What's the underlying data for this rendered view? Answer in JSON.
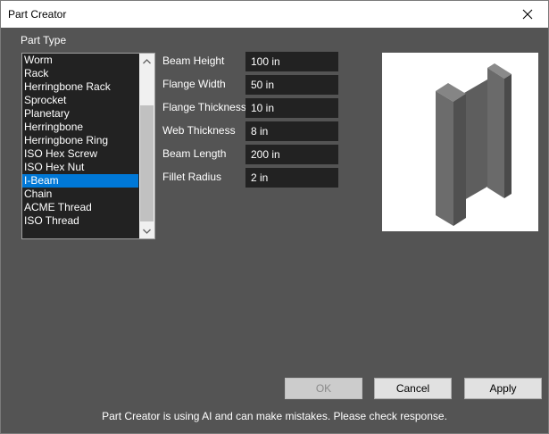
{
  "window": {
    "title": "Part Creator"
  },
  "part_type": {
    "label": "Part Type",
    "items": [
      "Worm",
      "Rack",
      "Herringbone Rack",
      "Sprocket",
      "Planetary",
      "Herringbone",
      "Herringbone Ring",
      "ISO Hex Screw",
      "ISO Hex Nut",
      "I-Beam",
      "Chain",
      "ACME Thread",
      "ISO Thread"
    ],
    "selected": "I-Beam"
  },
  "fields": [
    {
      "label": "Beam Height",
      "value": "100 in"
    },
    {
      "label": "Flange Width",
      "value": "50 in"
    },
    {
      "label": "Flange Thickness",
      "value": "10 in"
    },
    {
      "label": "Web Thickness",
      "value": "8 in"
    },
    {
      "label": "Beam Length",
      "value": "200 in"
    },
    {
      "label": "Fillet Radius",
      "value": "2 in"
    }
  ],
  "buttons": {
    "ok": "OK",
    "cancel": "Cancel",
    "apply": "Apply"
  },
  "footer": {
    "disclaimer": "Part Creator is using AI and can make mistakes. Please check response."
  },
  "icons": {
    "close": "close-icon",
    "scroll_up": "chevron-up-icon",
    "scroll_down": "chevron-down-icon"
  },
  "colors": {
    "background": "#545454",
    "selection": "#0078d7",
    "field_bg": "#222222"
  }
}
